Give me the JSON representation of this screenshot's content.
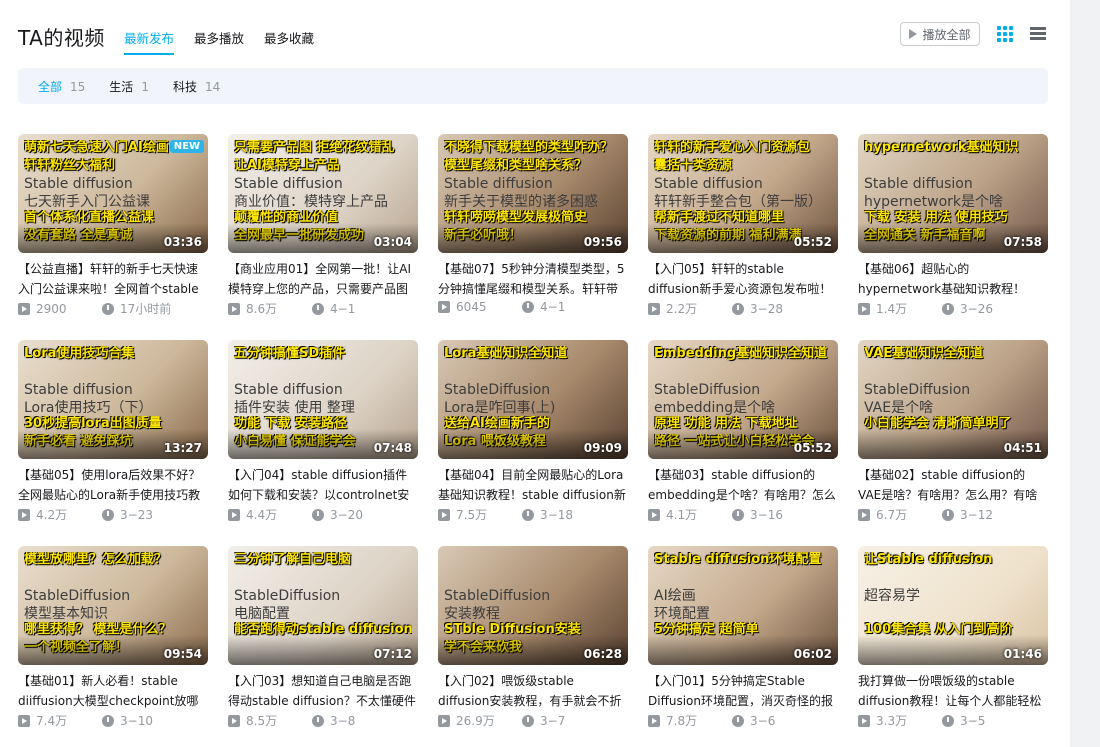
{
  "header": {
    "title": "TA的视频",
    "tabs": [
      {
        "label": "最新发布",
        "active": true
      },
      {
        "label": "最多播放",
        "active": false
      },
      {
        "label": "最多收藏",
        "active": false
      }
    ],
    "play_all": "播放全部",
    "accent": "#00aeec"
  },
  "filters": [
    {
      "label": "全部",
      "count": "15",
      "active": true
    },
    {
      "label": "生活",
      "count": "1",
      "active": false
    },
    {
      "label": "科技",
      "count": "14",
      "active": false
    }
  ],
  "videos": [
    {
      "lines": [
        "萌新七天急速入门AI绘画",
        "轩轩粉丝大福利",
        "Stable diffusion",
        "七天新手入门公益课",
        "首个体系化直播公益课",
        "没有套路 全是真诚"
      ],
      "new_badge": "NEW",
      "duration": "03:36",
      "title": "【公益直播】轩轩的新手七天快速入门公益课来啦！全网首个stable",
      "plays": "2900",
      "date": "17小时前"
    },
    {
      "lines": [
        "只需要产品图 拒绝花纹错乱",
        "让AI模特穿上产品",
        "Stable diffusion",
        "商业价值：模特穿上产品",
        "颠覆性的商业价值",
        "全网最早一批研发成功"
      ],
      "duration": "03:04",
      "title": "【商业应用01】全网第一批！让AI模特穿上您的产品，只需要产品图",
      "plays": "8.6万",
      "date": "4−1"
    },
    {
      "lines": [
        "不晓得下载模型的类型咋办？",
        "模型尾缀和类型啥关系？",
        "Stable diffusion",
        "新手关于模型的诸多困惑",
        "轩轩唠唠模型发展极简史",
        "新手必听哦！"
      ],
      "duration": "09:56",
      "title": "【基础07】5秒钟分清模型类型，5分钟搞懂尾缀和模型关系。轩轩带",
      "plays": "6045",
      "date": "4−1"
    },
    {
      "lines": [
        "轩轩的新手爱心入门资源包",
        "囊括十类资源",
        "Stable diffusion",
        "轩轩新手整合包（第一版）",
        "帮新手渡过不知道哪里",
        "下载资源的前期 福利满满"
      ],
      "duration": "05:52",
      "title": "【入门05】轩轩的stable diffusion新手爱心资源包发布啦！不要给学",
      "plays": "2.2万",
      "date": "3−28"
    },
    {
      "lines": [
        "hypernetwork基础知识",
        "",
        "Stable diffusion",
        "hypernetwork是个啥",
        "下载 安装 用法 使用技巧",
        "全网通关 新手福音啊"
      ],
      "duration": "07:58",
      "title": "【基础06】超贴心的hypernetwork基础知识教程！stable diffusion新",
      "plays": "1.4万",
      "date": "3−26"
    },
    {
      "lines": [
        "Lora使用技巧合集",
        "",
        "Stable diffusion",
        "Lora使用技巧（下）",
        "30秒提高lora出图质量",
        "新手必看 避免踩坑"
      ],
      "duration": "13:27",
      "title": "【基础05】使用lora后效果不好？全网最贴心的Lora新手使用技巧教",
      "plays": "4.2万",
      "date": "3−23"
    },
    {
      "lines": [
        "五分钟搞懂SD插件",
        "",
        "Stable diffusion",
        "插件安装 使用 整理",
        "功能 下载 安装路径",
        "小白易懂 保证能学会"
      ],
      "duration": "07:48",
      "title": "【入门04】stable diffusion插件如何下载和安装？以controlnet安装为",
      "plays": "4.4万",
      "date": "3−20"
    },
    {
      "lines": [
        "Lora基础知识全知道",
        "",
        "StableDiffusion",
        "Lora是咋回事(上)",
        "送给AI绘画新手的",
        "Lora 喂饭级教程"
      ],
      "duration": "09:09",
      "title": "【基础04】目前全网最贴心的Lora基础知识教程！stable diffusion新",
      "plays": "7.5万",
      "date": "3−18"
    },
    {
      "lines": [
        "Embedding基础知识全知道",
        "",
        "StableDiffusion",
        "embedding是个啥",
        "原理 功能 用法 下载地址",
        "路径 一站式让小白轻松学会"
      ],
      "duration": "05:52",
      "title": "【基础03】stable diffusion的embedding是个啥？有啥用？怎么",
      "plays": "4.1万",
      "date": "3−16"
    },
    {
      "lines": [
        "VAE基础知识全知道",
        "",
        "StableDiffusion",
        "VAE是个啥",
        "小白能学会 清晰简单明了",
        ""
      ],
      "duration": "04:51",
      "title": "【基础02】stable diffusion的VAE是啥？有啥用？怎么用？有啥效",
      "plays": "6.7万",
      "date": "3−12"
    },
    {
      "lines": [
        "模型放哪里？怎么加载？",
        "",
        "StableDiffusion",
        "模型基本知识",
        "哪里获得？ 模型是什么？",
        "一个视频全了解！"
      ],
      "duration": "09:54",
      "title": "【基础01】新人必看！stable diiffusion大模型checkpoint放哪",
      "plays": "7.4万",
      "date": "3−10"
    },
    {
      "lines": [
        "三分钟了解自己电脑",
        "",
        "StableDiffusion",
        "电脑配置",
        "能否跑得动stable diffusion",
        ""
      ],
      "duration": "07:12",
      "title": "【入门03】想知道自己电脑是否跑得动stable diffusion？不太懂硬件",
      "plays": "8.5万",
      "date": "3−8"
    },
    {
      "lines": [
        "",
        "",
        "StableDiffusion",
        "安装教程",
        "STble Diffusion安装",
        "学不会来砍我"
      ],
      "duration": "06:28",
      "title": "【入门02】喂饭级stable diffusion安装教程，有手就会不折腾",
      "plays": "26.9万",
      "date": "3−7"
    },
    {
      "lines": [
        "Stable diffusion环境配置",
        "",
        "AI绘画",
        "环境配置",
        "5分钟搞定 超简单",
        ""
      ],
      "duration": "06:02",
      "title": "【入门01】5分钟搞定Stable Diffusion环境配置，消灭奇怪的报",
      "plays": "7.8万",
      "date": "3−6"
    },
    {
      "lines": [
        "让Stable diffusion",
        "",
        "超容易学",
        "",
        "100集合集 从入门到高阶",
        ""
      ],
      "duration": "01:46",
      "title": "我打算做一份喂饭级的stable diffusion教程！让每个人都能轻松",
      "plays": "3.3万",
      "date": "3−5"
    }
  ]
}
